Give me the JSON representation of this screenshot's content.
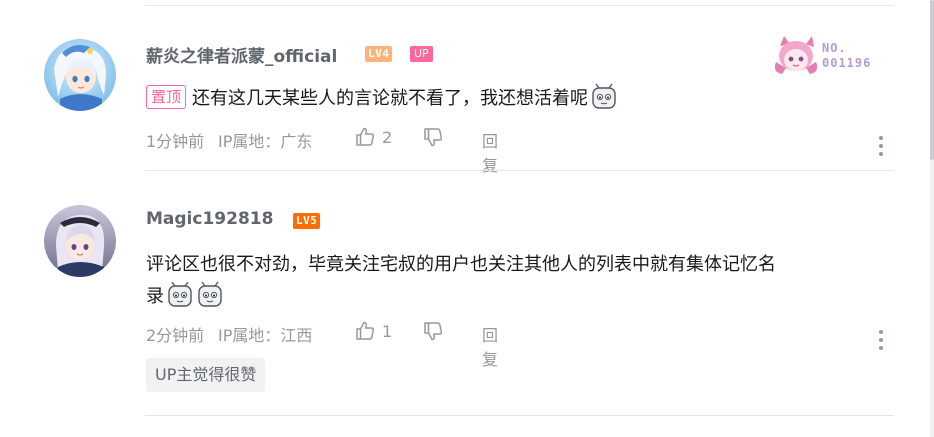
{
  "comments": [
    {
      "username": "薪炎之律者派蒙_official",
      "level": "LV4",
      "up_badge": "UP",
      "decoration_card": {
        "number_label": "NO.",
        "number_value": "001196"
      },
      "pinned_tag": "置顶",
      "text": "还有这几天某些人的言论就不看了，我还想活着呢",
      "emote_icons": [
        "tv-doge-emote-icon"
      ],
      "time": "1分钟前",
      "ip_location": "IP属地：广东",
      "likes": "2",
      "reply_label": "回复"
    },
    {
      "username": "Magic192818",
      "level": "LV5",
      "text_line1": "评论区也很不对劲，毕竟关注宅叔的用户也关注其他人的列表中就有集体记忆名",
      "text_line2": "录",
      "emote_icons": [
        "tv-doge-emote-icon",
        "tv-doge-emote-icon"
      ],
      "time": "2分钟前",
      "ip_location": "IP属地：江西",
      "likes": "1",
      "reply_label": "回复",
      "up_like_tag": "UP主觉得很赞"
    }
  ],
  "colors": {
    "username": "#61666d",
    "meta": "#9499a0",
    "up_pink": "#ff6699",
    "lv4": "#ffb37c",
    "lv5": "#ff6c00"
  }
}
